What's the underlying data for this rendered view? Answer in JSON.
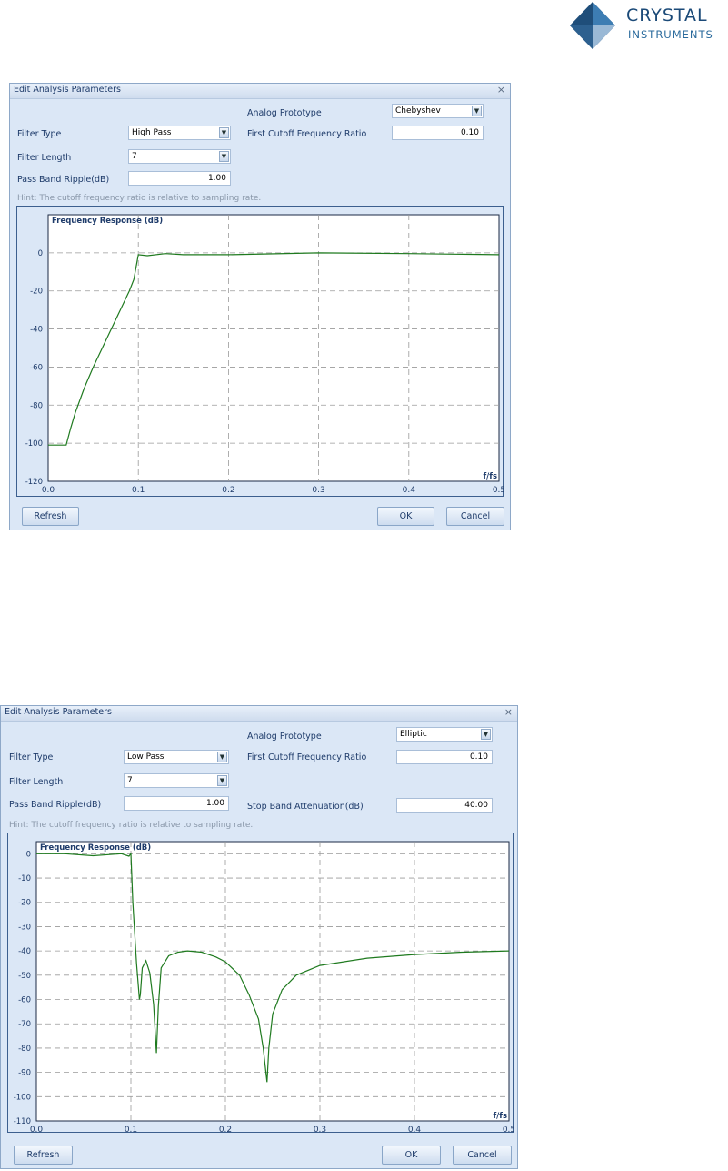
{
  "brand": {
    "name_line1": "CRYSTAL",
    "name_line2": "INSTRUMENTS"
  },
  "dialogs": [
    {
      "title": "Edit Analysis Parameters",
      "close_glyph": "×",
      "analog_prototype_label": "Analog Prototype",
      "analog_prototype_value": "Chebyshev",
      "filter_type_label": "Filter Type",
      "filter_type_value": "High Pass",
      "first_cutoff_label": "First Cutoff Frequency Ratio",
      "first_cutoff_value": "0.10",
      "filter_length_label": "Filter Length",
      "filter_length_value": "7",
      "ripple_label": "Pass Band Ripple(dB)",
      "ripple_value": "1.00",
      "hint": "Hint: The cutoff frequency ratio is relative to sampling rate.",
      "refresh_label": "Refresh",
      "ok_label": "OK",
      "cancel_label": "Cancel",
      "chart_data": {
        "type": "line",
        "title": "Frequency Response (dB)",
        "xlabel": "f/fs",
        "ylabel": "",
        "xlim": [
          0,
          0.5
        ],
        "ylim": [
          -120,
          20
        ],
        "x_ticks": [
          "0.0",
          "0.1",
          "0.2",
          "0.3",
          "0.4",
          "0.5"
        ],
        "y_ticks": [
          "0",
          "-20",
          "-40",
          "-60",
          "-80",
          "-100",
          "-120"
        ],
        "grid": true,
        "series": [
          {
            "x": [
              0,
              0.02,
              0.025,
              0.03,
              0.04,
              0.05,
              0.06,
              0.07,
              0.08,
              0.09,
              0.095,
              0.1,
              0.11,
              0.13,
              0.15,
              0.2,
              0.3,
              0.4,
              0.5
            ],
            "y": [
              -101,
              -101,
              -92,
              -84,
              -71,
              -60,
              -50,
              -40,
              -30,
              -20,
              -14,
              -1,
              -1.5,
              -0.4,
              -1,
              -1,
              0,
              -0.4,
              -1
            ],
            "color": "#1f7a1f"
          }
        ]
      }
    },
    {
      "title": "Edit Analysis Parameters",
      "close_glyph": "×",
      "analog_prototype_label": "Analog Prototype",
      "analog_prototype_value": "Elliptic",
      "filter_type_label": "Filter Type",
      "filter_type_value": "Low Pass",
      "first_cutoff_label": "First Cutoff Frequency Ratio",
      "first_cutoff_value": "0.10",
      "filter_length_label": "Filter Length",
      "filter_length_value": "7",
      "ripple_label": "Pass Band Ripple(dB)",
      "ripple_value": "1.00",
      "stopband_label": "Stop Band Attenuation(dB)",
      "stopband_value": "40.00",
      "hint": "Hint: The cutoff frequency ratio is relative to sampling rate.",
      "refresh_label": "Refresh",
      "ok_label": "OK",
      "cancel_label": "Cancel",
      "chart_data": {
        "type": "line",
        "title": "Frequency Response (dB)",
        "xlabel": "f/fs",
        "ylabel": "",
        "xlim": [
          0,
          0.5
        ],
        "ylim": [
          -110,
          5
        ],
        "x_ticks": [
          "0.0",
          "0.1",
          "0.2",
          "0.3",
          "0.4",
          "0.5"
        ],
        "y_ticks": [
          "0",
          "-10",
          "-20",
          "-30",
          "-40",
          "-50",
          "-60",
          "-70",
          "-80",
          "-90",
          "-100",
          "-110"
        ],
        "grid": true,
        "series": [
          {
            "x": [
              0,
              0.03,
              0.06,
              0.09,
              0.098,
              0.1,
              0.102,
              0.106,
              0.109,
              0.11,
              0.112,
              0.116,
              0.12,
              0.124,
              0.127,
              0.129,
              0.132,
              0.14,
              0.15,
              0.16,
              0.175,
              0.19,
              0.2,
              0.215,
              0.225,
              0.235,
              0.24,
              0.244,
              0.246,
              0.25,
              0.26,
              0.275,
              0.3,
              0.35,
              0.4,
              0.45,
              0.5
            ],
            "y": [
              0,
              0,
              -0.8,
              0,
              -1,
              0,
              -20,
              -45,
              -60,
              -58,
              -47,
              -44,
              -49,
              -62,
              -82,
              -63,
              -47,
              -42,
              -40.5,
              -40,
              -40.5,
              -42.5,
              -44.5,
              -50,
              -58,
              -68,
              -80,
              -94,
              -80,
              -66,
              -56,
              -50,
              -46,
              -43,
              -41.5,
              -40.5,
              -40
            ],
            "color": "#1f7a1f"
          }
        ]
      }
    }
  ]
}
